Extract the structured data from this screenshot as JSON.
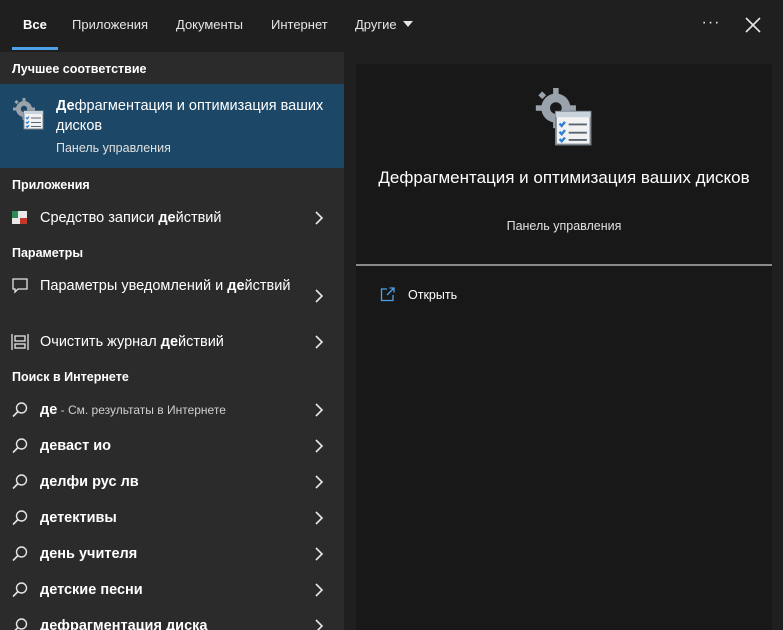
{
  "tabs": [
    {
      "label": "Все"
    },
    {
      "label": "Приложения"
    },
    {
      "label": "Документы"
    },
    {
      "label": "Интернет"
    },
    {
      "label": "Другие"
    }
  ],
  "toolbar": {
    "more_glyph": "···",
    "more_icon": "ellipsis-icon",
    "close_icon": "close-icon"
  },
  "colors": {
    "accent": "#4ea1e8",
    "selected_bg": "#1c4766",
    "panel_bg": "#2b2b2b",
    "preview_bg": "#181818"
  },
  "sections": {
    "best_match": "Лучшее соответствие",
    "apps": "Приложения",
    "settings": "Параметры",
    "web": "Поиск в Интернете"
  },
  "best_match": {
    "title": "Дефрагментация и оптимизация ваших дисков",
    "title_hl": "Де",
    "title_rest": "фрагментация и оптимизация ваших дисков",
    "subtitle": "Панель управления",
    "icon": "defrag-icon"
  },
  "apps": [
    {
      "pre": "Средство записи ",
      "hl": "де",
      "post": "йствий",
      "icon": "steps-recorder-icon"
    }
  ],
  "settings": [
    {
      "pre": "Параметры уведомлений и ",
      "hl": "де",
      "post": "йствий",
      "icon": "notification-icon"
    },
    {
      "pre": "Очистить журнал ",
      "hl": "де",
      "post": "йствий",
      "icon": "timeline-icon"
    }
  ],
  "web": [
    {
      "query": "де",
      "suffix": " - См. результаты в Интернете"
    },
    {
      "query": "деваст ио",
      "suffix": ""
    },
    {
      "query": "делфи рус лв",
      "suffix": ""
    },
    {
      "query": "детективы",
      "suffix": ""
    },
    {
      "query": "день учителя",
      "suffix": ""
    },
    {
      "query": "детские песни",
      "suffix": ""
    },
    {
      "query": "дефрагментация диска",
      "suffix": ""
    }
  ],
  "preview": {
    "title": "Дефрагментация и оптимизация ваших дисков",
    "subtitle": "Панель управления",
    "actions": [
      {
        "label": "Открыть",
        "icon": "open-icon"
      }
    ]
  }
}
